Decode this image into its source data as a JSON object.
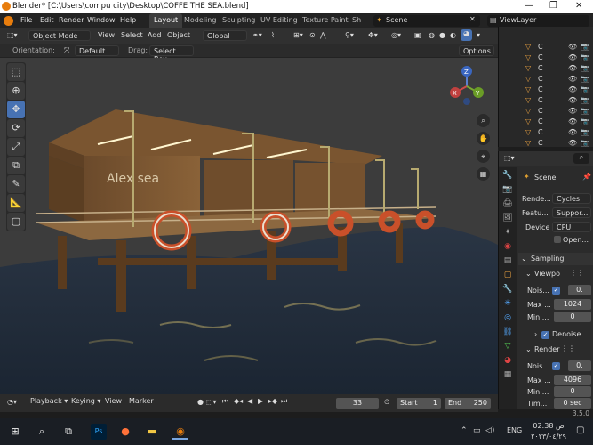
{
  "window": {
    "title": "Blender* [C:\\Users\\compu city\\Desktop\\COFFE THE SEA.blend]"
  },
  "menu": [
    "File",
    "Edit",
    "Render",
    "Window",
    "Help"
  ],
  "workspaces": [
    "Layout",
    "Modeling",
    "Sculpting",
    "UV Editing",
    "Texture Paint",
    "Sh"
  ],
  "scene": {
    "name": "Scene",
    "view_layer": "ViewLayer"
  },
  "header": {
    "mode": "Object Mode",
    "view": "View",
    "select": "Select",
    "add": "Add",
    "object": "Object",
    "transform": "Global"
  },
  "header2": {
    "orientation_label": "Orientation:",
    "orientation": "Default",
    "drag_label": "Drag:",
    "drag": "Select Box",
    "options": "Options"
  },
  "sign_text": "Alex sea",
  "gizmo": {
    "x": "X",
    "y": "Y",
    "z": "Z"
  },
  "outliner_rows": [
    "C",
    "C",
    "C",
    "C",
    "C",
    "C",
    "C",
    "C",
    "C",
    "C"
  ],
  "properties": {
    "scene": "Scene",
    "render_engine_label": "Rende...",
    "render_engine": "Cycles",
    "feature_label": "Featu...",
    "feature": "Suppor...",
    "device_label": "Device",
    "device": "CPU",
    "open_label": "Open...",
    "sampling": "Sampling",
    "viewport": "Viewpo",
    "vp_noise_label": "Nois...",
    "vp_noise": "0.",
    "vp_max_label": "Max ...",
    "vp_max": "1024",
    "vp_min_label": "Min ...",
    "vp_min": "0",
    "denoise": "Denoise",
    "render": "Render",
    "r_noise_label": "Nois...",
    "r_noise": "0.",
    "r_max_label": "Max ...",
    "r_max": "4096",
    "r_min_label": "Min ...",
    "r_min": "0",
    "r_time_label": "Tim...",
    "r_time": "0 sec"
  },
  "timeline": {
    "playback": "Playback",
    "keying": "Keying",
    "view": "View",
    "marker": "Marker",
    "frame": "33",
    "start_label": "Start",
    "start": "1",
    "end_label": "End",
    "end": "250"
  },
  "version": "3.5.0",
  "taskbar": {
    "lang": "ENG",
    "time": "02:38 ص",
    "date": "٢٠٢٣/٠٤/٢٩"
  }
}
